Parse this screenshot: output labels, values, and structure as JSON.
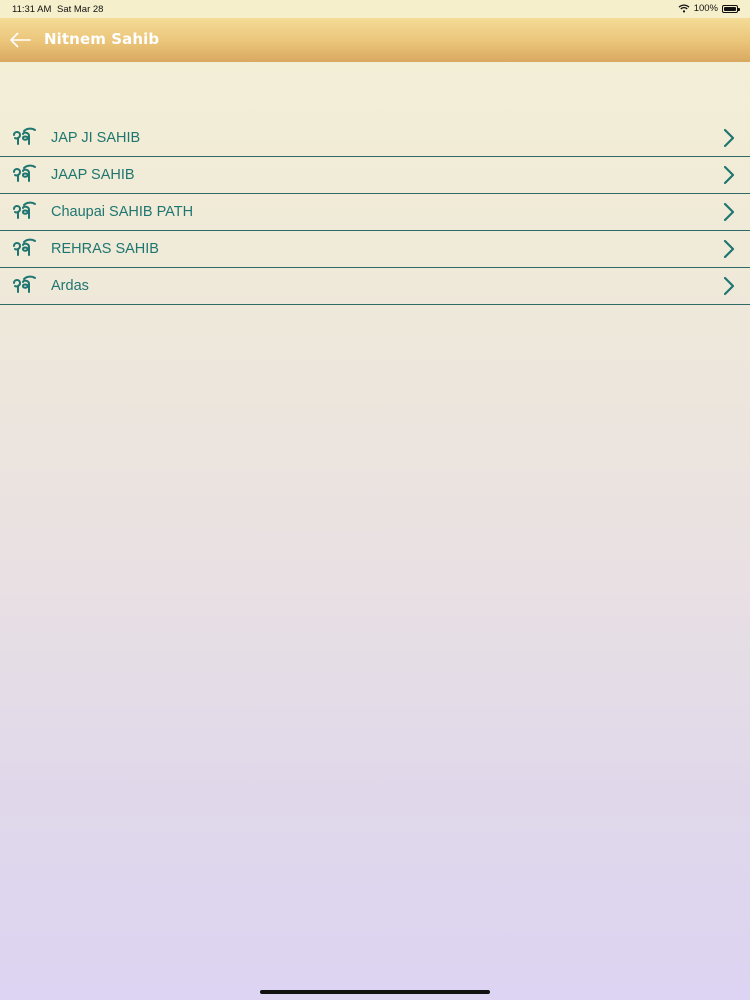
{
  "status_bar": {
    "time": "11:31 AM",
    "date": "Sat Mar 28",
    "battery": "100%"
  },
  "header": {
    "title": "Nitnem Sahib",
    "back_icon": "arrow-left-icon"
  },
  "list": {
    "items": [
      {
        "label": "JAP JI SAHIB",
        "icon": "ik-onkar-icon"
      },
      {
        "label": "JAAP SAHIB",
        "icon": "ik-onkar-icon"
      },
      {
        "label": "Chaupai SAHIB PATH",
        "icon": "ik-onkar-icon"
      },
      {
        "label": "REHRAS SAHIB",
        "icon": "ik-onkar-icon"
      },
      {
        "label": "Ardas",
        "icon": "ik-onkar-icon"
      }
    ]
  },
  "colors": {
    "accent": "#1f7671",
    "divider": "#2f6b66",
    "header_top": "#f5dc97",
    "header_bottom": "#d9a860"
  }
}
